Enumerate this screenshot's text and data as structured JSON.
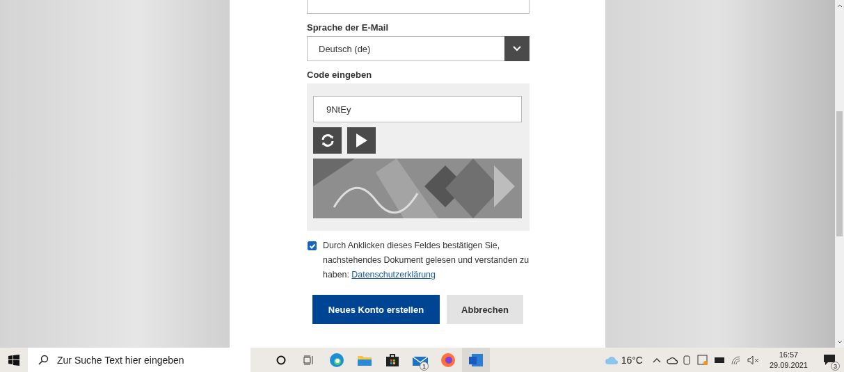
{
  "form": {
    "language_label": "Sprache der E-Mail",
    "language_value": "Deutsch (de)",
    "code_label": "Code eingeben",
    "code_value": "9NtEy",
    "consent": {
      "checked": true,
      "text": "Durch Anklicken dieses Feldes bestätigen Sie, nachstehendes Dokument gelesen und verstanden zu haben:",
      "link": "Datenschutzerklärung"
    },
    "buttons": [
      {
        "label": "Neues Konto erstellen",
        "kind": "primary"
      },
      {
        "label": "Abbrechen",
        "kind": "secondary"
      }
    ]
  },
  "taskbar": {
    "search_placeholder": "Zur Suche Text hier eingeben",
    "mail_badge": "1",
    "weather": "16°C",
    "time": "16:57",
    "date": "29.09.2021",
    "notification_badge": "3"
  }
}
